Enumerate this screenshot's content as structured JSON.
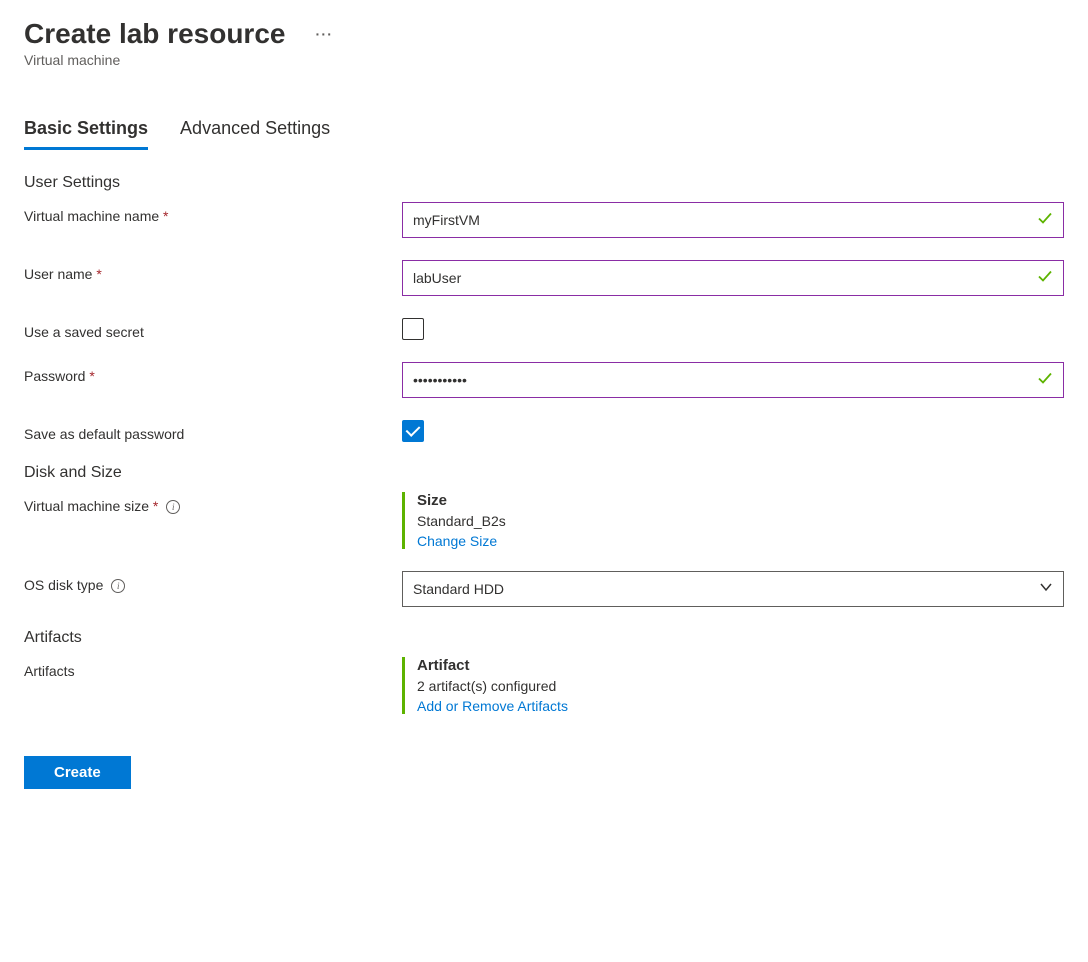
{
  "header": {
    "title": "Create lab resource",
    "subtitle": "Virtual machine"
  },
  "tabs": {
    "basic": "Basic Settings",
    "advanced": "Advanced Settings"
  },
  "sections": {
    "user_settings": "User Settings",
    "disk_and_size": "Disk and Size",
    "artifacts": "Artifacts"
  },
  "labels": {
    "vm_name": "Virtual machine name",
    "user_name": "User name",
    "use_saved_secret": "Use a saved secret",
    "password": "Password",
    "save_default_password": "Save as default password",
    "vm_size": "Virtual machine size",
    "os_disk_type": "OS disk type",
    "artifacts": "Artifacts"
  },
  "values": {
    "vm_name": "myFirstVM",
    "user_name": "labUser",
    "password": "•••••••••••",
    "use_saved_secret_checked": false,
    "save_default_password_checked": true,
    "os_disk_type": "Standard HDD"
  },
  "vm_size_block": {
    "title": "Size",
    "value": "Standard_B2s",
    "link": "Change Size"
  },
  "artifacts_block": {
    "title": "Artifact",
    "value": "2 artifact(s) configured",
    "link": "Add or Remove Artifacts"
  },
  "buttons": {
    "create": "Create"
  }
}
